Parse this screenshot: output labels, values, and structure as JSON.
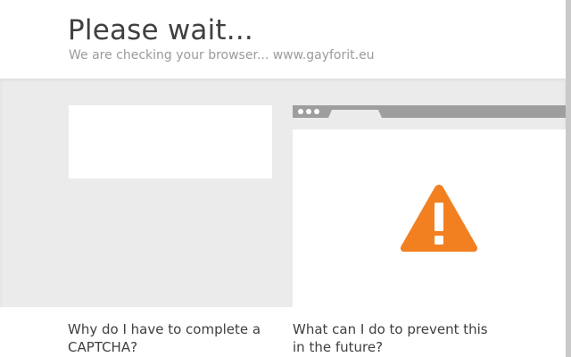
{
  "header": {
    "title": "Please wait...",
    "subtitle": "We are checking your browser... www.gayforit.eu"
  },
  "illustration": {
    "icon": "warning-icon",
    "icon_color": "#f38020",
    "bar_color": "#9e9e9e"
  },
  "questions": [
    {
      "text": "Why do I have to complete a CAPTCHA?"
    },
    {
      "text": "What can I do to prevent this in the future?"
    }
  ]
}
